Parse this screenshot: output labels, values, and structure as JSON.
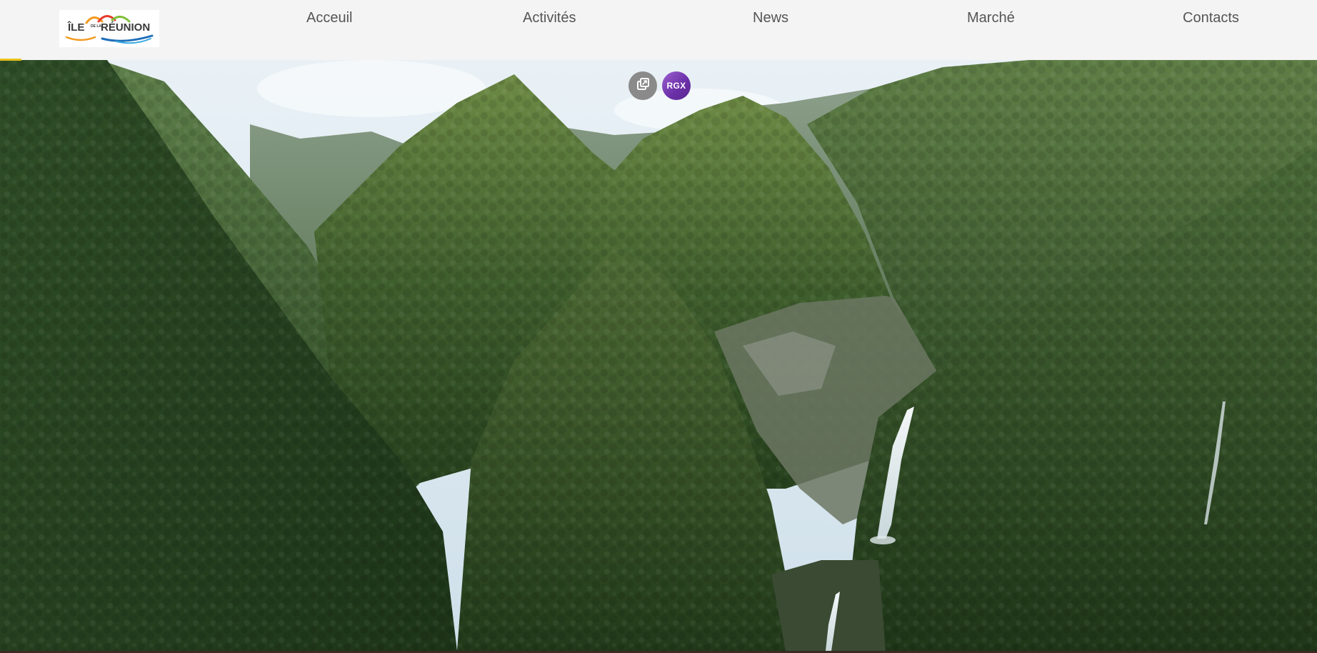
{
  "header": {
    "logo": {
      "text_ile": "ÎLE",
      "text_de_la": "DE LA",
      "text_reunion": "RÉUNION",
      "colors": {
        "text": "#3a3a3a",
        "arc_orange": "#f29a1f",
        "arc_red": "#e53a2b",
        "arc_green": "#7fbf3a",
        "wave_blue": "#1f6fb8",
        "wave_lightblue": "#39a9e0"
      }
    },
    "nav": [
      {
        "label": "Acceuil"
      },
      {
        "label": "Activités"
      },
      {
        "label": "News"
      },
      {
        "label": "Marché"
      },
      {
        "label": "Contacts"
      }
    ],
    "background": "#f4f4f4",
    "accent": "#e8c21a"
  },
  "hero": {
    "description_icon": "mountain-waterfall-landscape"
  },
  "overlay_buttons": {
    "popout_icon": "external-window-icon",
    "rgx_label": "RGX"
  }
}
